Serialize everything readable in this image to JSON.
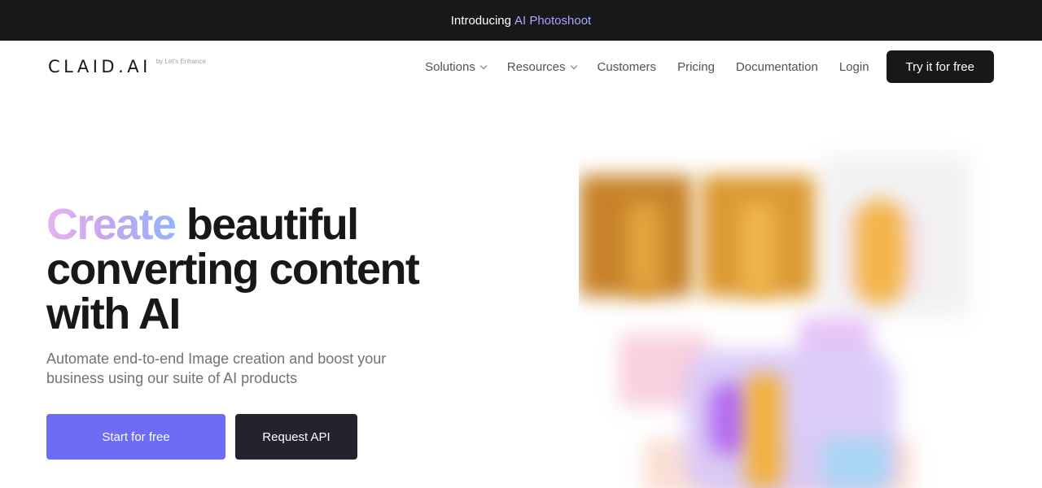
{
  "announcement": {
    "prefix": "Introducing",
    "highlight": "AI Photoshoot"
  },
  "header": {
    "logo_text": "CLAID.AI",
    "logo_sub": "by Let's Enhance",
    "nav": [
      {
        "label": "Solutions",
        "dropdown": true
      },
      {
        "label": "Resources",
        "dropdown": true
      },
      {
        "label": "Customers",
        "dropdown": false
      },
      {
        "label": "Pricing",
        "dropdown": false
      },
      {
        "label": "Documentation",
        "dropdown": false
      },
      {
        "label": "Login",
        "dropdown": false
      }
    ],
    "cta_label": "Try it for free"
  },
  "hero": {
    "title_highlight": "Create",
    "title_rest": " beautiful converting content with AI",
    "subtitle": "Automate end-to-end Image creation and boost your business using our suite of AI products",
    "primary_button": "Start for free",
    "secondary_button": "Request API"
  },
  "colors": {
    "announce_bg": "#18181b",
    "primary": "#6c6cf5",
    "dark_button": "#23232e",
    "text_dark": "#18181b",
    "text_muted": "#71717a"
  }
}
